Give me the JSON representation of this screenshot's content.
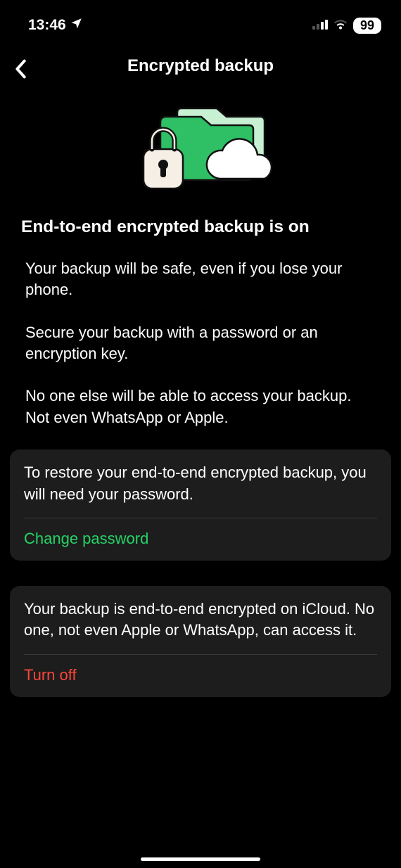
{
  "status_bar": {
    "time": "13:46",
    "battery": "99"
  },
  "header": {
    "title": "Encrypted backup"
  },
  "main": {
    "heading": "End-to-end encrypted backup is on",
    "para1": "Your backup will be safe, even if you lose your phone.",
    "para2": "Secure your backup with a password or an encryption key.",
    "para3": "No one else will be able to access your backup. Not even WhatsApp or Apple."
  },
  "card1": {
    "text": "To restore your end-to-end encrypted backup, you will need your password.",
    "action": "Change password"
  },
  "card2": {
    "text": "Your backup is end-to-end encrypted on iCloud. No one, not even Apple or WhatsApp, can access it.",
    "action": "Turn off"
  },
  "colors": {
    "accent_green": "#25D366",
    "danger_red": "#ff453a",
    "card_bg": "#1d1d1d"
  }
}
